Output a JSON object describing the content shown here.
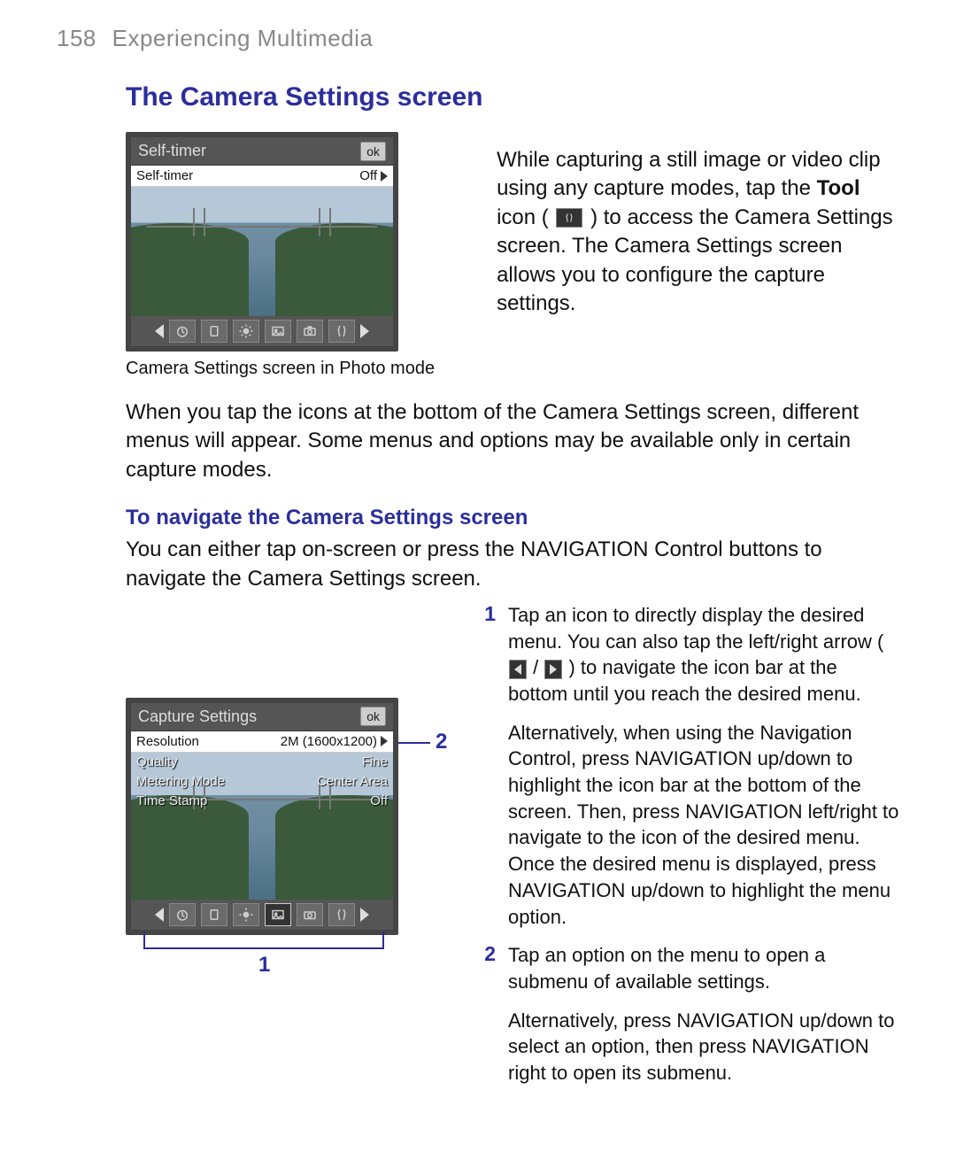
{
  "page": {
    "number": "158",
    "section": "Experiencing Multimedia"
  },
  "heading": "The Camera Settings screen",
  "intro": {
    "text_before_bold": "While capturing a still image or video clip using any capture modes, tap the ",
    "bold_word": "Tool",
    "text_after_bold": " icon ( ",
    "text_after_icon": " ) to access the Camera Settings screen. The Camera Settings screen allows you to configure the capture settings."
  },
  "fig1": {
    "title": "Self-timer",
    "ok": "ok",
    "row1_label": "Self-timer",
    "row1_value": "Off",
    "caption": "Camera Settings screen in Photo mode"
  },
  "mid_para": "When you tap the icons at the bottom of the Camera Settings screen, different menus will appear. Some menus and options may be available only in certain capture modes.",
  "subheading": "To navigate the Camera Settings screen",
  "sub_intro": "You can either tap on-screen or press the NAVIGATION Control buttons to navigate the Camera Settings screen.",
  "fig2": {
    "title": "Capture Settings",
    "ok": "ok",
    "rows": [
      {
        "label": "Resolution",
        "value": "2M (1600x1200)",
        "selected": true
      },
      {
        "label": "Quality",
        "value": "Fine",
        "selected": false
      },
      {
        "label": "Metering Mode",
        "value": "Center Area",
        "selected": false
      },
      {
        "label": "Time Stamp",
        "value": "Off",
        "selected": false
      }
    ]
  },
  "callouts": {
    "c1": "1",
    "c2": "2"
  },
  "steps": [
    {
      "num": "1",
      "p1a": "Tap an icon to directly display the desired menu. You can also tap the left/right arrow ( ",
      "p1b": " / ",
      "p1c": " ) to navigate the icon bar at the bottom until you reach the desired menu.",
      "p2": "Alternatively, when using the Navigation Control, press NAVIGATION up/down to highlight the icon bar at the bottom of the screen. Then, press NAVIGATION left/right to navigate to the icon of the desired menu. Once the desired menu is displayed, press NAVIGATION up/down to highlight the menu option."
    },
    {
      "num": "2",
      "p1": "Tap an option on the menu to open a submenu of available settings.",
      "p2": "Alternatively, press NAVIGATION up/down to select an option, then press NAVIGATION right to open its submenu."
    }
  ]
}
